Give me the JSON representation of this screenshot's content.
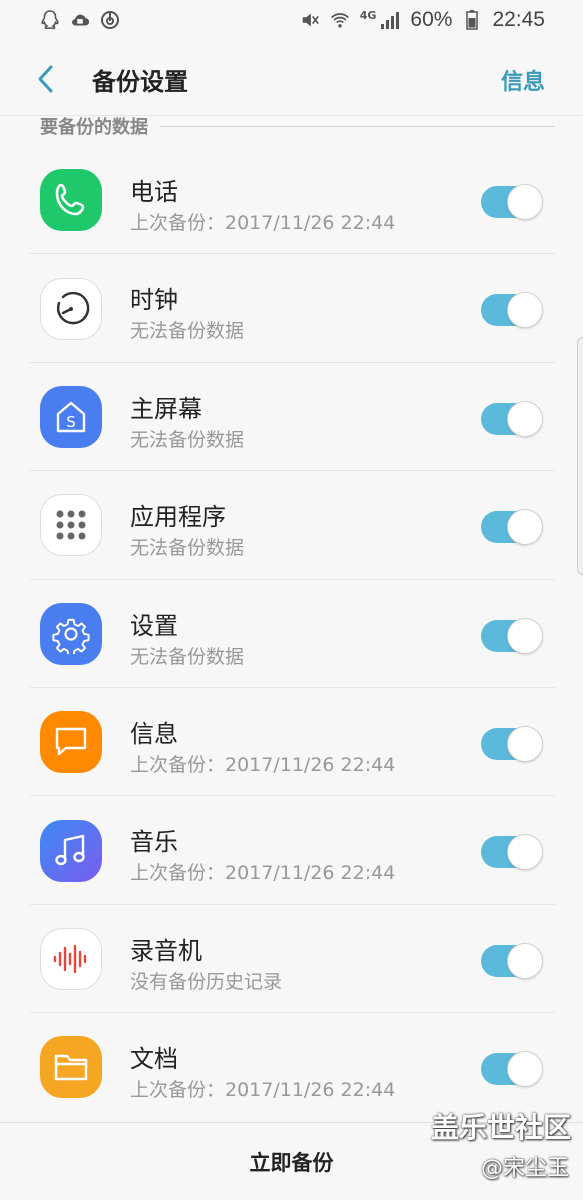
{
  "status_bar": {
    "battery": "60%",
    "time": "22:45",
    "network": "4G"
  },
  "header": {
    "title": "备份设置",
    "action": "信息"
  },
  "section": {
    "label": "要备份的数据"
  },
  "items": [
    {
      "title": "电话",
      "subtitle": "上次备份：2017/11/26 22:44",
      "icon": "phone-icon",
      "color": "#1fc96b",
      "enabled": true
    },
    {
      "title": "时钟",
      "subtitle": "无法备份数据",
      "icon": "clock-icon",
      "color": "#ffffff",
      "enabled": true
    },
    {
      "title": "主屏幕",
      "subtitle": "无法备份数据",
      "icon": "home-screen-icon",
      "color": "#4a7ef0",
      "enabled": true
    },
    {
      "title": "应用程序",
      "subtitle": "无法备份数据",
      "icon": "apps-grid-icon",
      "color": "#ffffff",
      "enabled": true
    },
    {
      "title": "设置",
      "subtitle": "无法备份数据",
      "icon": "gear-icon",
      "color": "#4a7ef0",
      "enabled": true
    },
    {
      "title": "信息",
      "subtitle": "上次备份：2017/11/26 22:44",
      "icon": "message-icon",
      "color": "#ff8a00",
      "enabled": true
    },
    {
      "title": "音乐",
      "subtitle": "上次备份：2017/11/26 22:44",
      "icon": "music-icon",
      "color": "#4d7cf2",
      "enabled": true
    },
    {
      "title": "录音机",
      "subtitle": "没有备份历史记录",
      "icon": "voice-recorder-icon",
      "color": "#ffffff",
      "enabled": true
    },
    {
      "title": "文档",
      "subtitle": "上次备份：2017/11/26 22:44",
      "icon": "folder-icon",
      "color": "#f5a623",
      "enabled": true
    }
  ],
  "bottom": {
    "button_label": "立即备份"
  },
  "watermark": {
    "brand": "盖乐世社区",
    "user": "@宋尘玉"
  },
  "colors": {
    "accent": "#3a9ab8",
    "toggle_on": "#5bb9dc"
  }
}
